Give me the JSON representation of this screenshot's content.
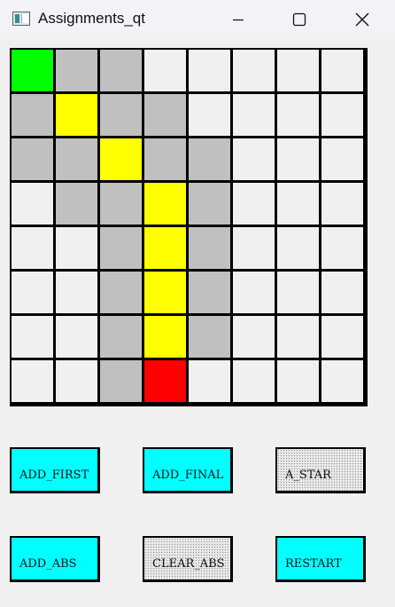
{
  "window": {
    "title": "Assignments_qt"
  },
  "colors": {
    "empty": "#f0f0f0",
    "visited": "#c0c0c0",
    "path": "#ffff00",
    "start": "#00ff00",
    "goal": "#ff0000",
    "button_active": "#00ffff"
  },
  "grid": {
    "rows": 8,
    "cols": 8,
    "cells": [
      [
        "start",
        "visited",
        "visited",
        "empty",
        "empty",
        "empty",
        "empty",
        "empty"
      ],
      [
        "visited",
        "path",
        "visited",
        "visited",
        "empty",
        "empty",
        "empty",
        "empty"
      ],
      [
        "visited",
        "visited",
        "path",
        "visited",
        "visited",
        "empty",
        "empty",
        "empty"
      ],
      [
        "empty",
        "visited",
        "visited",
        "path",
        "visited",
        "empty",
        "empty",
        "empty"
      ],
      [
        "empty",
        "empty",
        "visited",
        "path",
        "visited",
        "empty",
        "empty",
        "empty"
      ],
      [
        "empty",
        "empty",
        "visited",
        "path",
        "visited",
        "empty",
        "empty",
        "empty"
      ],
      [
        "empty",
        "empty",
        "visited",
        "path",
        "visited",
        "empty",
        "empty",
        "empty"
      ],
      [
        "empty",
        "empty",
        "visited",
        "goal",
        "empty",
        "empty",
        "empty",
        "empty"
      ]
    ]
  },
  "buttons": {
    "add_first": "ADD_FIRST",
    "add_final": "ADD_FINAL",
    "a_star": "A_STAR",
    "add_abs": "ADD_ABS",
    "clear_abs": "CLEAR_ABS",
    "restart": "RESTART"
  }
}
